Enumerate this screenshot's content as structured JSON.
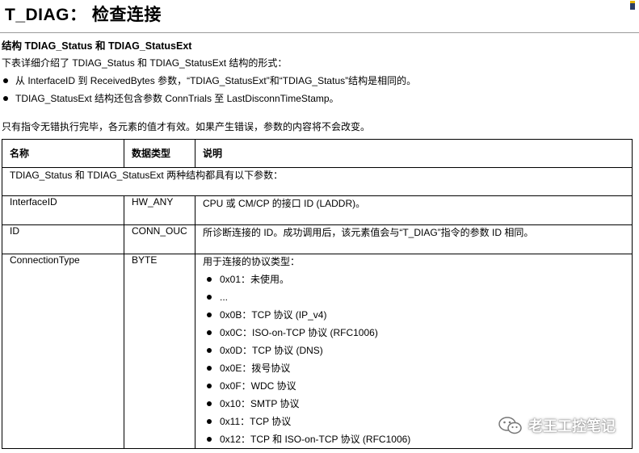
{
  "header": {
    "title": "T_DIAG： 检查连接"
  },
  "section": {
    "heading": "结构 TDIAG_Status 和 TDIAG_StatusExt",
    "intro": "下表详细介绍了 TDIAG_Status 和 TDIAG_StatusExt 结构的形式：",
    "bullets": [
      "从 InterfaceID 到 ReceivedBytes 参数，“TDIAG_StatusExt”和“TDIAG_Status”结构是相同的。",
      "TDIAG_StatusExt 结构还包含参数 ConnTrials 至 LastDisconnTimeStamp。"
    ],
    "note": "只有指令无错执行完毕，各元素的值才有效。如果产生错误，参数的内容将不会改变。"
  },
  "table": {
    "headers": [
      "名称",
      "数据类型",
      "说明"
    ],
    "span_row": "TDIAG_Status 和 TDIAG_StatusExt 两种结构都具有以下参数：",
    "rows": [
      {
        "name": "InterfaceID",
        "type": "HW_ANY",
        "desc": "CPU 或 CM/CP 的接口 ID (LADDR)。"
      },
      {
        "name": "ID",
        "type": "CONN_OUC",
        "desc": "所诊断连接的 ID。成功调用后，该元素值会与“T_DIAG”指令的参数 ID 相同。"
      },
      {
        "name": "ConnectionType",
        "type": "BYTE",
        "desc": "用于连接的协议类型："
      }
    ],
    "connection_types": [
      "0x01：未使用。",
      "...",
      "0x0B：TCP 协议 (IP_v4)",
      "0x0C：ISO-on-TCP 协议 (RFC1006)",
      "0x0D：TCP 协议 (DNS)",
      "0x0E：拨号协议",
      "0x0F：WDC 协议",
      "0x10：SMTP 协议",
      "0x11：TCP 协议",
      "0x12：TCP 和 ISO-on-TCP 协议 (RFC1006)"
    ]
  },
  "watermark": {
    "text": "老王工控笔记",
    "icon": "wechat-icon"
  }
}
